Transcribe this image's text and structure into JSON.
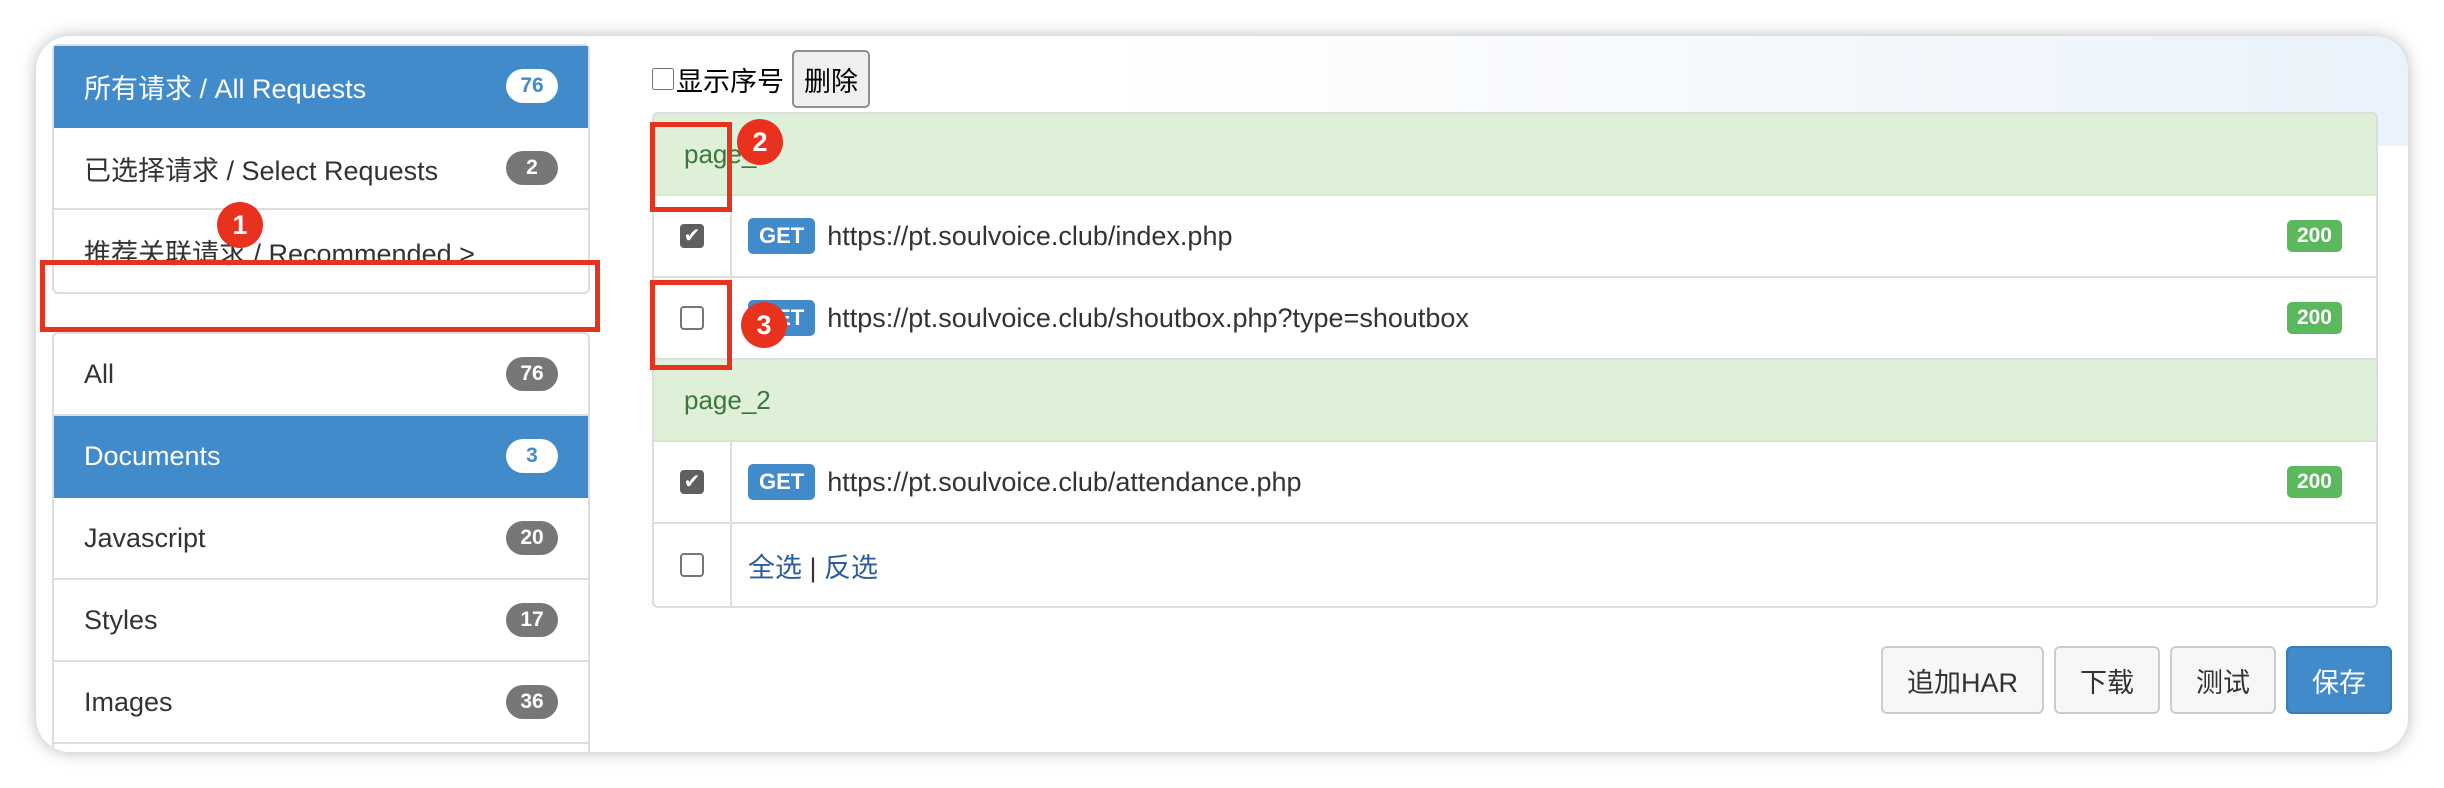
{
  "sidebar": {
    "request_filters": [
      {
        "label": "所有请求 / All Requests",
        "count": "76",
        "active": true
      },
      {
        "label": "已选择请求 / Select Requests",
        "count": "2",
        "active": false
      },
      {
        "label": "推荐关联请求 / Recommended >",
        "count": "",
        "active": false
      }
    ],
    "type_filters": [
      {
        "label": "All",
        "count": "76",
        "active": false
      },
      {
        "label": "Documents",
        "count": "3",
        "active": true
      },
      {
        "label": "Javascript",
        "count": "20",
        "active": false
      },
      {
        "label": "Styles",
        "count": "17",
        "active": false
      },
      {
        "label": "Images",
        "count": "36",
        "active": false
      }
    ]
  },
  "toolbar": {
    "show_index_label": "显示序号",
    "delete_label": "删除"
  },
  "groups": [
    {
      "name": "page_1",
      "requests": [
        {
          "checked": true,
          "method": "GET",
          "url": "https://pt.soulvoice.club/index.php",
          "status": "200"
        },
        {
          "checked": false,
          "method": "GET",
          "url": "https://pt.soulvoice.club/shoutbox.php?type=shoutbox",
          "status": "200"
        }
      ]
    },
    {
      "name": "page_2",
      "requests": [
        {
          "checked": true,
          "method": "GET",
          "url": "https://pt.soulvoice.club/attendance.php",
          "status": "200"
        }
      ]
    }
  ],
  "selection": {
    "select_all": "全选",
    "separator": "|",
    "invert": "反选"
  },
  "actions": {
    "append_har": "追加HAR",
    "download": "下载",
    "test": "测试",
    "save": "保存"
  },
  "annotations": {
    "marker_1": "1",
    "marker_2": "2",
    "marker_3": "3",
    "color": "#e8321e"
  },
  "colors": {
    "primary": "#428bca",
    "success": "#5cb85c",
    "group_bg": "#dff0d8",
    "group_text": "#3c763d",
    "badge_gray": "#777777"
  }
}
